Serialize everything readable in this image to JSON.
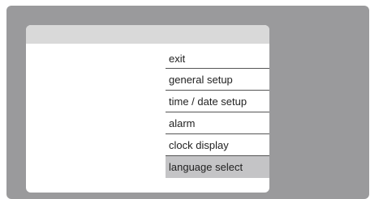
{
  "colors": {
    "frame_background": "#9a9a9c",
    "panel_background": "#ffffff",
    "header_bar": "#d9d9d9",
    "selected_item": "#c4c4c6"
  },
  "menu": {
    "items": [
      {
        "label": "exit",
        "selected": false
      },
      {
        "label": "general setup",
        "selected": false
      },
      {
        "label": "time / date setup",
        "selected": false
      },
      {
        "label": "alarm",
        "selected": false
      },
      {
        "label": "clock display",
        "selected": false
      },
      {
        "label": "language select",
        "selected": true
      }
    ]
  }
}
